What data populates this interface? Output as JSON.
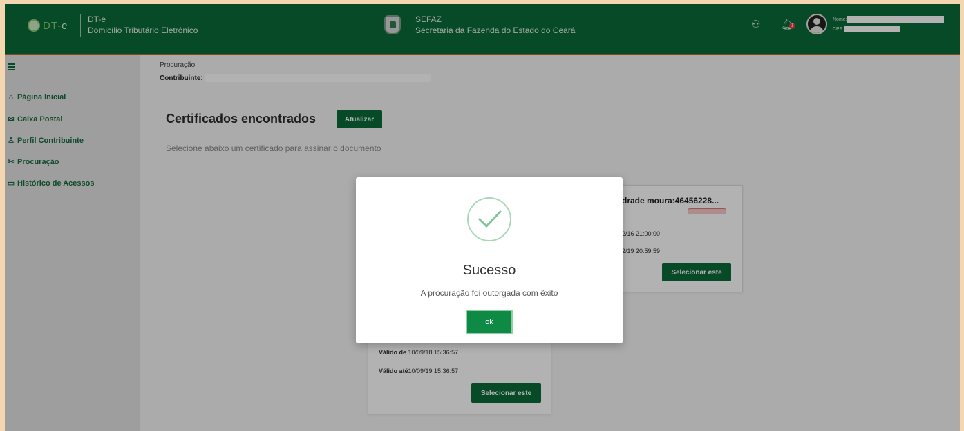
{
  "header": {
    "logo_text_a": "DT-",
    "logo_text_b": "e",
    "app_name": "DT-e",
    "app_full_name": "Domicílio Tributário Eletrônico",
    "org_short": "SEFAZ",
    "org_full": "Secretaria da Fazenda do Estado do Ceará",
    "notification_count": "1",
    "user_name_label": "Nome:",
    "user_cpf_label": "CPF:"
  },
  "sidebar": {
    "items": [
      {
        "label": "Página Inicial",
        "icon": "home-icon"
      },
      {
        "label": "Caixa Postal",
        "icon": "mail-icon"
      },
      {
        "label": "Perfil Contribuinte",
        "icon": "user-icon"
      },
      {
        "label": "Procuração",
        "icon": "handshake-icon"
      },
      {
        "label": "Histórico de Acessos",
        "icon": "folder-icon"
      }
    ]
  },
  "main": {
    "breadcrumb": "Procuração",
    "contributor_label": "Contribuinte:",
    "section_title": "Certificados encontrados",
    "refresh_button": "Atualizar",
    "subtitle": "Selecione abaixo um certificado para assinar o documento"
  },
  "cards": {
    "right": {
      "name_fragment": "drade moura:46456228...",
      "date_from_fragment": "2/16 21:00:00",
      "date_to_fragment": "2/19 20:59:59",
      "select_button": "Selecionar este"
    },
    "bottom": {
      "valid_from_label": "Válido de",
      "valid_from_value": " 10/09/18 15:36:57",
      "valid_to_label": "Válido até",
      "valid_to_value": "10/09/19 15:36:57",
      "select_button": "Selecionar este"
    }
  },
  "modal": {
    "title": "Sucesso",
    "message": "A procuração foi outorgada com êxito",
    "ok_button": "ok",
    "icon": "check-circle-icon"
  },
  "colors": {
    "brand_green": "#0b6b3a",
    "frame_bg": "#f4d6b0"
  }
}
